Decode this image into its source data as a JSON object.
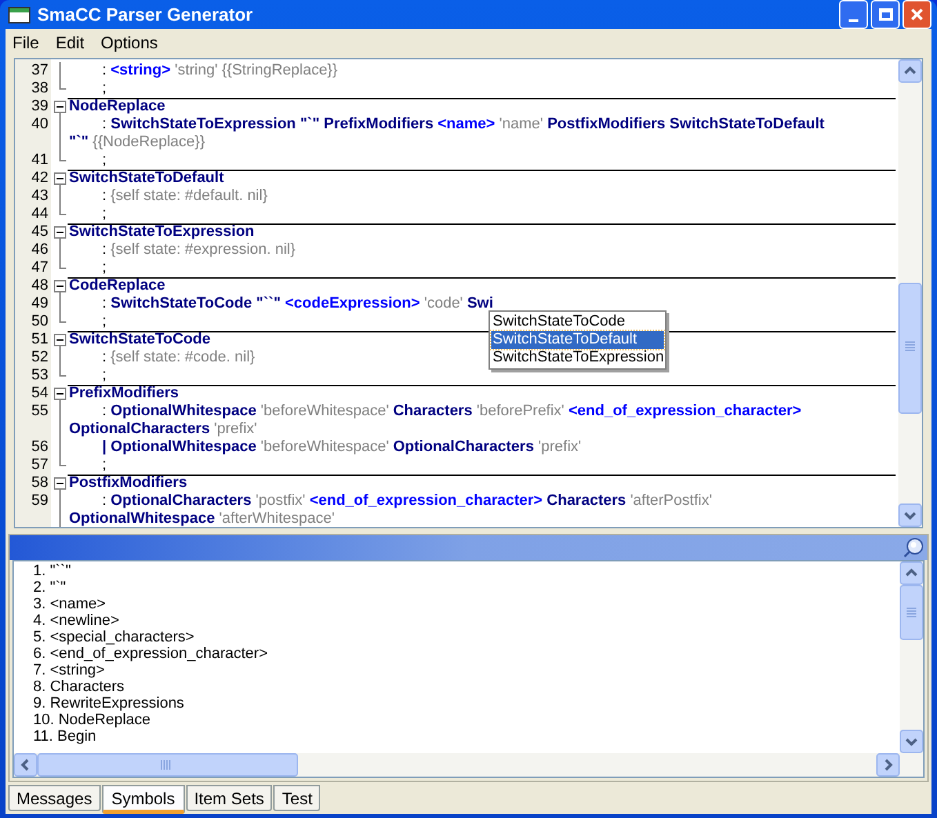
{
  "window": {
    "title": "SmaCC Parser Generator"
  },
  "menu": [
    "File",
    "Edit",
    "Options"
  ],
  "editor": {
    "rows": [
      {
        "number": "37",
        "kind": "body",
        "lines": [
          [
            {
              "kind": "punct",
              "text": ": "
            },
            {
              "kind": "token",
              "text": "<string>"
            },
            {
              "kind": "name",
              "text": " 'string' {{StringReplace}}"
            }
          ]
        ]
      },
      {
        "number": "38",
        "kind": "end",
        "lines": [
          [
            {
              "kind": "punct",
              "text": ";"
            }
          ]
        ]
      },
      {
        "number": "39",
        "kind": "head",
        "lines": [
          [
            {
              "kind": "rule",
              "text": "NodeReplace"
            }
          ]
        ]
      },
      {
        "number": "40",
        "kind": "body",
        "lines": [
          [
            {
              "kind": "punct",
              "text": ": "
            },
            {
              "kind": "rule",
              "text": "SwitchStateToExpression \"`\" PrefixModifiers "
            },
            {
              "kind": "token",
              "text": "<name>"
            },
            {
              "kind": "name",
              "text": " 'name' "
            },
            {
              "kind": "rule",
              "text": "PostfixModifiers SwitchStateToDefault"
            }
          ],
          [
            {
              "kind": "rule",
              "text": "\"`\""
            },
            {
              "kind": "name",
              "text": " {{NodeReplace}}"
            }
          ]
        ]
      },
      {
        "number": "41",
        "kind": "end",
        "lines": [
          [
            {
              "kind": "punct",
              "text": ";"
            }
          ]
        ]
      },
      {
        "number": "42",
        "kind": "head",
        "lines": [
          [
            {
              "kind": "rule",
              "text": "SwitchStateToDefault"
            }
          ]
        ]
      },
      {
        "number": "43",
        "kind": "body",
        "lines": [
          [
            {
              "kind": "punct",
              "text": ": "
            },
            {
              "kind": "name",
              "text": "{self state: #default. nil}"
            }
          ]
        ]
      },
      {
        "number": "44",
        "kind": "end",
        "lines": [
          [
            {
              "kind": "punct",
              "text": ";"
            }
          ]
        ]
      },
      {
        "number": "45",
        "kind": "head",
        "lines": [
          [
            {
              "kind": "rule",
              "text": "SwitchStateToExpression"
            }
          ]
        ]
      },
      {
        "number": "46",
        "kind": "body",
        "lines": [
          [
            {
              "kind": "punct",
              "text": ": "
            },
            {
              "kind": "name",
              "text": "{self state: #expression. nil}"
            }
          ]
        ]
      },
      {
        "number": "47",
        "kind": "end",
        "lines": [
          [
            {
              "kind": "punct",
              "text": ";"
            }
          ]
        ]
      },
      {
        "number": "48",
        "kind": "head",
        "lines": [
          [
            {
              "kind": "rule",
              "text": "CodeReplace"
            }
          ]
        ]
      },
      {
        "number": "49",
        "kind": "body",
        "lines": [
          [
            {
              "kind": "punct",
              "text": ": "
            },
            {
              "kind": "rule",
              "text": "SwitchStateToCode \"``\" "
            },
            {
              "kind": "token",
              "text": "<codeExpression>"
            },
            {
              "kind": "name",
              "text": " 'code' "
            },
            {
              "kind": "rule",
              "text": "Swi"
            }
          ]
        ]
      },
      {
        "number": "50",
        "kind": "end",
        "lines": [
          [
            {
              "kind": "punct",
              "text": ";"
            }
          ]
        ]
      },
      {
        "number": "51",
        "kind": "head",
        "lines": [
          [
            {
              "kind": "rule",
              "text": "SwitchStateToCode"
            }
          ]
        ]
      },
      {
        "number": "52",
        "kind": "body",
        "lines": [
          [
            {
              "kind": "punct",
              "text": ": "
            },
            {
              "kind": "name",
              "text": "{self state: #code. nil}"
            }
          ]
        ]
      },
      {
        "number": "53",
        "kind": "end",
        "lines": [
          [
            {
              "kind": "punct",
              "text": ";"
            }
          ]
        ]
      },
      {
        "number": "54",
        "kind": "head",
        "lines": [
          [
            {
              "kind": "rule",
              "text": "PrefixModifiers"
            }
          ]
        ]
      },
      {
        "number": "55",
        "kind": "body",
        "lines": [
          [
            {
              "kind": "punct",
              "text": ": "
            },
            {
              "kind": "rule",
              "text": "OptionalWhitespace"
            },
            {
              "kind": "name",
              "text": " 'beforeWhitespace' "
            },
            {
              "kind": "rule",
              "text": "Characters"
            },
            {
              "kind": "name",
              "text": " 'beforePrefix' "
            },
            {
              "kind": "token",
              "text": "<end_of_expression_character>"
            }
          ],
          [
            {
              "kind": "rule",
              "text": "OptionalCharacters"
            },
            {
              "kind": "name",
              "text": " 'prefix'"
            }
          ]
        ]
      },
      {
        "number": "56",
        "kind": "body",
        "lines": [
          [
            {
              "kind": "rule",
              "text": "| OptionalWhitespace"
            },
            {
              "kind": "name",
              "text": " 'beforeWhitespace' "
            },
            {
              "kind": "rule",
              "text": "OptionalCharacters"
            },
            {
              "kind": "name",
              "text": " 'prefix'"
            }
          ]
        ]
      },
      {
        "number": "57",
        "kind": "end",
        "lines": [
          [
            {
              "kind": "punct",
              "text": ";"
            }
          ]
        ]
      },
      {
        "number": "58",
        "kind": "head",
        "lines": [
          [
            {
              "kind": "rule",
              "text": "PostfixModifiers"
            }
          ]
        ]
      },
      {
        "number": "59",
        "kind": "body",
        "lines": [
          [
            {
              "kind": "punct",
              "text": ": "
            },
            {
              "kind": "rule",
              "text": "OptionalCharacters"
            },
            {
              "kind": "name",
              "text": " 'postfix' "
            },
            {
              "kind": "token",
              "text": "<end_of_expression_character>"
            },
            {
              "kind": "rule",
              "text": " Characters"
            },
            {
              "kind": "name",
              "text": " 'afterPostfix'"
            }
          ],
          [
            {
              "kind": "rule",
              "text": "OptionalWhitespace"
            },
            {
              "kind": "name",
              "text": " 'afterWhitespace'"
            }
          ]
        ]
      }
    ]
  },
  "completion": [
    {
      "label": "SwitchStateToCode",
      "selected": false
    },
    {
      "label": "SwitchStateToDefault",
      "selected": true
    },
    {
      "label": "SwitchStateToExpression",
      "selected": false
    }
  ],
  "symbols": [
    "1. \"``\"",
    "2. \"`\"",
    "3. <name>",
    "4. <newline>",
    "5. <special_characters>",
    "6. <end_of_expression_character>",
    "7. <string>",
    "8. Characters",
    "9. RewriteExpressions",
    "10. NodeReplace",
    "11. Begin"
  ],
  "tabs": [
    {
      "label": "Messages",
      "selected": false
    },
    {
      "label": "Symbols",
      "selected": true
    },
    {
      "label": "Item Sets",
      "selected": false
    },
    {
      "label": "Test",
      "selected": false
    }
  ]
}
